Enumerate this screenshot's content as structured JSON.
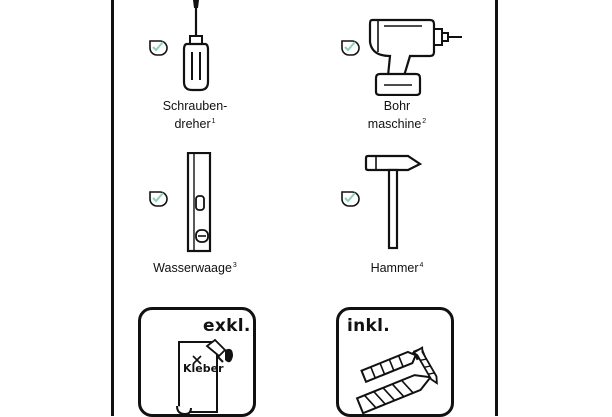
{
  "tools": [
    {
      "id": "schraubendreher",
      "line1": "Schrauben-",
      "line2": "dreher",
      "sup": "1",
      "icon": "screwdriver-icon",
      "check": "check-drop-icon"
    },
    {
      "id": "bohrmaschine",
      "line1": "Bohr",
      "line2": "maschine",
      "sup": "2",
      "icon": "drill-icon",
      "check": "check-drop-icon"
    },
    {
      "id": "wasserwaage",
      "line1": "",
      "line2": "Wasserwaage",
      "sup": "3",
      "icon": "spirit-level-icon",
      "check": "check-drop-icon"
    },
    {
      "id": "hammer",
      "line1": "",
      "line2": "Hammer",
      "sup": "4",
      "icon": "hammer-icon",
      "check": "check-drop-icon"
    }
  ],
  "cards": [
    {
      "id": "exkl",
      "tag": "exkl.",
      "item_label": "Kleber",
      "icon": "glue-scroll-icon"
    },
    {
      "id": "inkl",
      "tag": "inkl.",
      "icon": "dowels-screws-icon"
    }
  ],
  "colors": {
    "ink": "#111111",
    "accent": "#8fd0bd"
  }
}
